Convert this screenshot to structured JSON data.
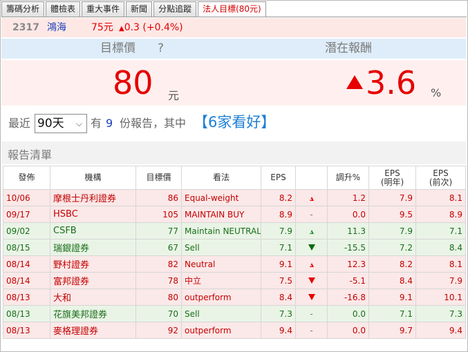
{
  "tabs": [
    {
      "label": "籌碼分析"
    },
    {
      "label": "體檢表"
    },
    {
      "label": "重大事件"
    },
    {
      "label": "新聞"
    },
    {
      "label": "分點追蹤"
    },
    {
      "label": "法人目標(80元)"
    }
  ],
  "quote": {
    "code": "2317",
    "name": "鴻海",
    "price": "75元",
    "change": "0.3 (+0.4%)",
    "change_direction": "up",
    "color_up": "#e60000"
  },
  "header": {
    "target_label": "目標價",
    "help": "?",
    "upside_label": "潛在報酬"
  },
  "big": {
    "target_value": "80",
    "target_unit": "元",
    "upside_value": "3.6",
    "upside_unit": "%",
    "upside_direction": "up"
  },
  "summary": {
    "prefix": "最近",
    "period": "90天",
    "has": "有",
    "count": "9",
    "suffix": "份報告，其中",
    "highlight": "【6家看好】"
  },
  "section_title": "報告清單",
  "table": {
    "columns": [
      "發佈",
      "機構",
      "目標價",
      "看法",
      "EPS",
      "",
      "調升%",
      "EPS\n(明年)",
      "EPS\n(前次)"
    ],
    "rows": [
      {
        "date": "10/06",
        "broker": "摩根士丹利證券",
        "target": "86",
        "view": "Equal-weight",
        "eps": "8.2",
        "trend": "up-open",
        "change": "1.2",
        "eps_next": "7.9",
        "eps_prev": "8.1",
        "tone": "red"
      },
      {
        "date": "09/17",
        "broker": "HSBC",
        "target": "105",
        "view": "MAINTAIN BUY",
        "eps": "8.9",
        "trend": "dash",
        "change": "0.0",
        "eps_next": "9.5",
        "eps_prev": "8.9",
        "tone": "red"
      },
      {
        "date": "09/02",
        "broker": "CSFB",
        "target": "77",
        "view": "Maintain NEUTRAL",
        "eps": "7.9",
        "trend": "up-open",
        "change": "11.3",
        "eps_next": "7.9",
        "eps_prev": "7.1",
        "tone": "green"
      },
      {
        "date": "08/15",
        "broker": "瑞銀證券",
        "target": "67",
        "view": "Sell",
        "eps": "7.1",
        "trend": "down-fill",
        "change": "-15.5",
        "eps_next": "7.2",
        "eps_prev": "8.4",
        "tone": "green"
      },
      {
        "date": "08/14",
        "broker": "野村證券",
        "target": "82",
        "view": "Neutral",
        "eps": "9.1",
        "trend": "up-open",
        "change": "12.3",
        "eps_next": "8.2",
        "eps_prev": "8.1",
        "tone": "red"
      },
      {
        "date": "08/14",
        "broker": "富邦證券",
        "target": "78",
        "view": "中立",
        "eps": "7.5",
        "trend": "down-fill",
        "change": "-5.1",
        "eps_next": "8.4",
        "eps_prev": "7.9",
        "tone": "red"
      },
      {
        "date": "08/13",
        "broker": "大和",
        "target": "80",
        "view": "outperform",
        "eps": "8.4",
        "trend": "down-fill",
        "change": "-16.8",
        "eps_next": "9.1",
        "eps_prev": "10.1",
        "tone": "red"
      },
      {
        "date": "08/13",
        "broker": "花旗美邦證券",
        "target": "70",
        "view": "Sell",
        "eps": "7.3",
        "trend": "dash",
        "change": "0.0",
        "eps_next": "7.1",
        "eps_prev": "7.3",
        "tone": "green"
      },
      {
        "date": "08/13",
        "broker": "麥格理證券",
        "target": "92",
        "view": "outperform",
        "eps": "9.4",
        "trend": "dash",
        "change": "0.0",
        "eps_next": "9.7",
        "eps_prev": "9.4",
        "tone": "red"
      }
    ],
    "colors": {
      "red_row_bg": "#fbe8e8",
      "red_text": "#c40000",
      "green_row_bg": "#e9f4e6",
      "green_text": "#1a6e1a"
    }
  }
}
